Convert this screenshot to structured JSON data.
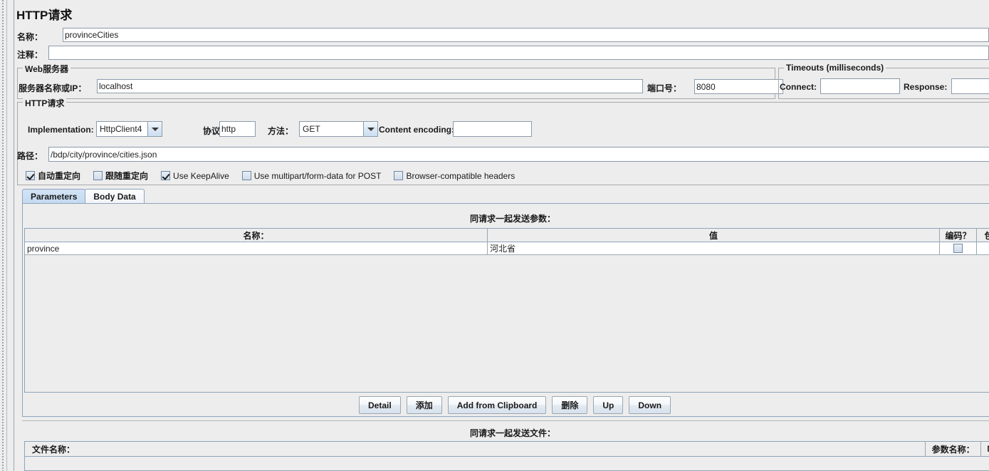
{
  "page_title": "HTTP请求",
  "fields": {
    "name_label": "名称：",
    "name_value": "provinceCities",
    "comment_label": "注释：",
    "comment_value": ""
  },
  "web_server": {
    "group_title": "Web服务器",
    "server_label": "服务器名称或IP：",
    "server_value": "localhost",
    "port_label": "端口号：",
    "port_value": "8080"
  },
  "timeouts": {
    "group_title": "Timeouts (milliseconds)",
    "connect_label": "Connect:",
    "connect_value": "",
    "response_label": "Response:",
    "response_value": ""
  },
  "http_request": {
    "group_title": "HTTP请求",
    "implementation_label": "Implementation:",
    "implementation_value": "HttpClient4",
    "protocol_label": "协议：",
    "protocol_value": "http",
    "method_label": "方法：",
    "method_value": "GET",
    "content_encoding_label": "Content encoding:",
    "content_encoding_value": "",
    "path_label": "路径：",
    "path_value": "/bdp/city/province/cities.json",
    "checkboxes": [
      {
        "label": "自动重定向",
        "checked": true,
        "bold": true
      },
      {
        "label": "跟随重定向",
        "checked": false,
        "bold": true
      },
      {
        "label": "Use KeepAlive",
        "checked": true,
        "bold": false
      },
      {
        "label": "Use multipart/form-data for POST",
        "checked": false,
        "bold": false
      },
      {
        "label": "Browser-compatible headers",
        "checked": false,
        "bold": false
      }
    ]
  },
  "tabs": [
    {
      "label": "Parameters",
      "active": true
    },
    {
      "label": "Body Data",
      "active": false
    }
  ],
  "parameters": {
    "caption": "同请求一起发送参数：",
    "columns": [
      "名称：",
      "值",
      "编码？",
      "包"
    ],
    "rows": [
      {
        "name": "province",
        "value": "河北省",
        "encode": false,
        "include": ""
      }
    ],
    "buttons": [
      "Detail",
      "添加",
      "Add from Clipboard",
      "删除",
      "Up",
      "Down"
    ]
  },
  "files": {
    "caption": "同请求一起发送文件：",
    "columns": [
      "文件名称：",
      "参数名称：",
      "MI"
    ]
  },
  "colors": {
    "panel_bg": "#ededed",
    "field_bg": "#ffffff",
    "border": "#8fa4ba",
    "tab_active": "#c9dcf1",
    "text": "#1a1a1a"
  }
}
